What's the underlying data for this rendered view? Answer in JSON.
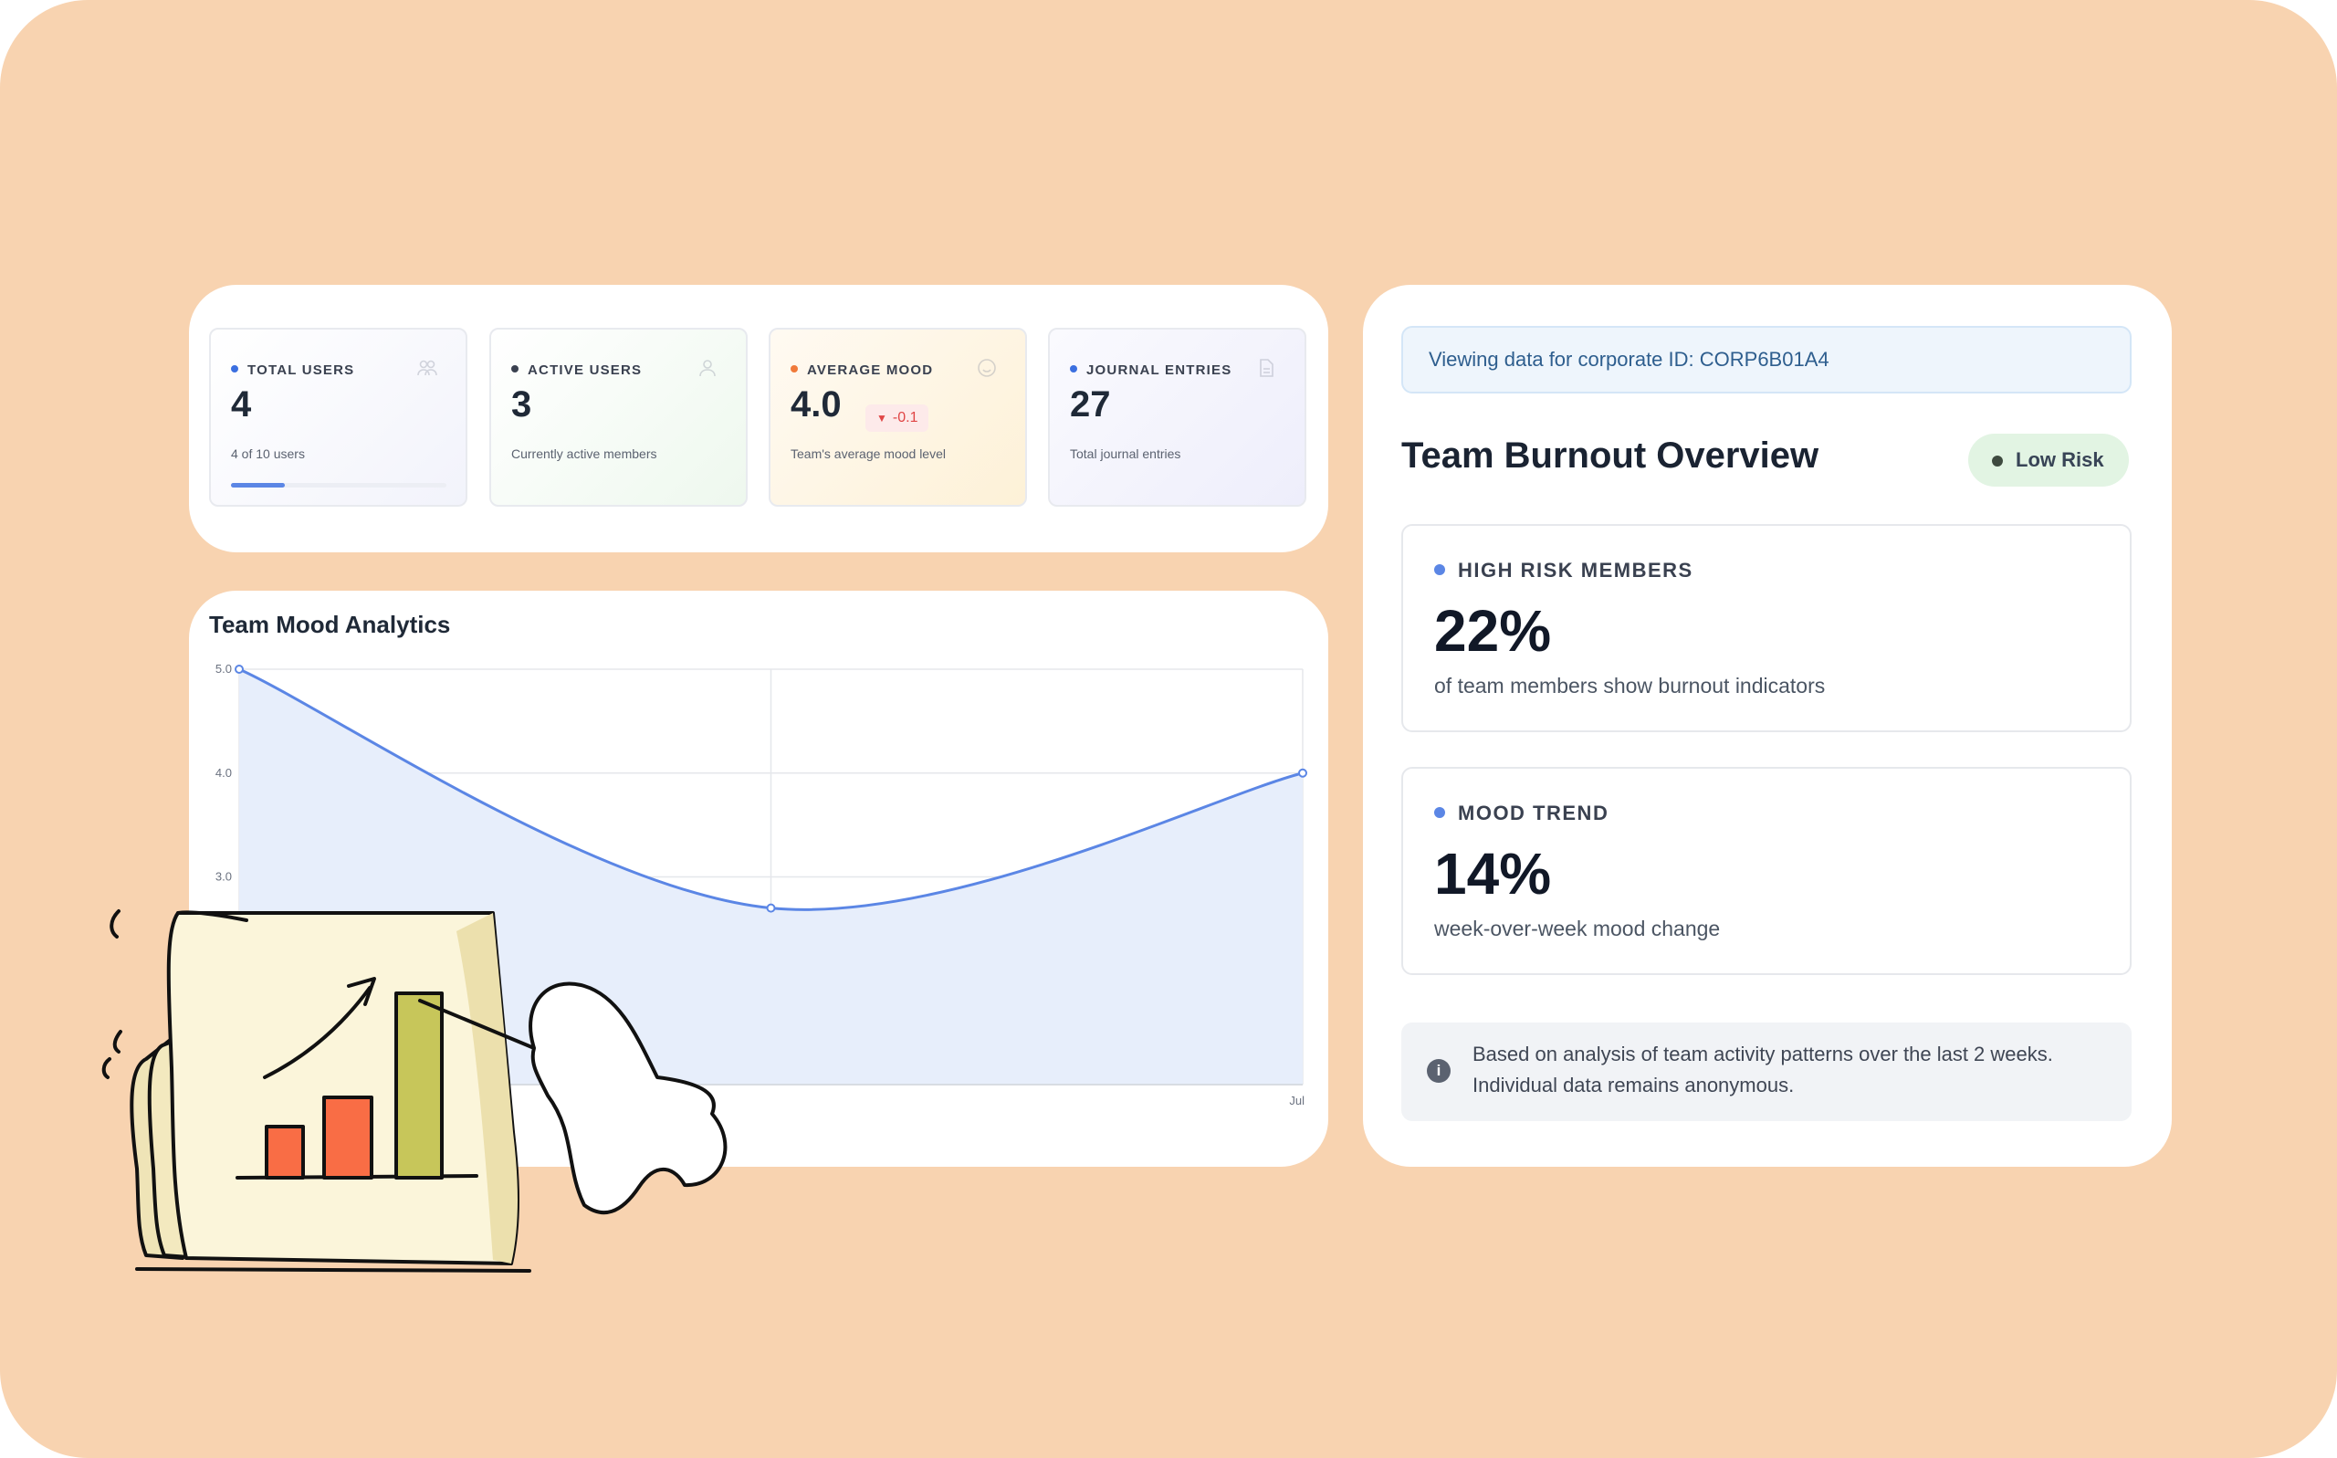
{
  "stats": [
    {
      "label": "TOTAL USERS",
      "value": "4",
      "sub": "4 of 10 users",
      "dot_color": "#3b6fe0",
      "icon": "users-icon",
      "progress": 0.25
    },
    {
      "label": "ACTIVE USERS",
      "value": "3",
      "sub": "Currently active members",
      "dot_color": "#3a4150",
      "icon": "user-icon"
    },
    {
      "label": "AVERAGE MOOD",
      "value": "4.0",
      "sub": "Team's average mood level",
      "dot_color": "#f07a3a",
      "icon": "smile-icon",
      "delta": "-0.1"
    },
    {
      "label": "JOURNAL ENTRIES",
      "value": "27",
      "sub": "Total journal entries",
      "dot_color": "#3b6fe0",
      "icon": "document-icon"
    }
  ],
  "chart": {
    "title": "Team Mood Analytics"
  },
  "chart_data": {
    "type": "area",
    "title": "Team Mood Analytics",
    "y_ticks": [
      "5.0",
      "4.0",
      "3.0"
    ],
    "x_tick_visible": "Jul",
    "ylim": [
      1.0,
      5.0
    ],
    "grid": true,
    "series": [
      {
        "values": [
          5.0,
          2.7,
          4.0
        ]
      }
    ],
    "line_color": "#5b86e5",
    "fill_color": "#e7eefb"
  },
  "burnout": {
    "banner": "Viewing data for corporate ID: CORP6B01A4",
    "title": "Team Burnout Overview",
    "risk_badge": "Low Risk",
    "high_risk": {
      "label": "HIGH RISK MEMBERS",
      "value": "22%",
      "desc": "of team members show burnout indicators"
    },
    "mood_trend": {
      "label": "MOOD TREND",
      "value": "14%",
      "desc": "week-over-week mood change"
    },
    "info": "Based on analysis of team activity patterns over the last 2 weeks. Individual data remains anonymous."
  },
  "colors": {
    "background": "#f8d3b0",
    "accent": "#5b86e5",
    "low_risk_bg": "#e2f4e3"
  }
}
